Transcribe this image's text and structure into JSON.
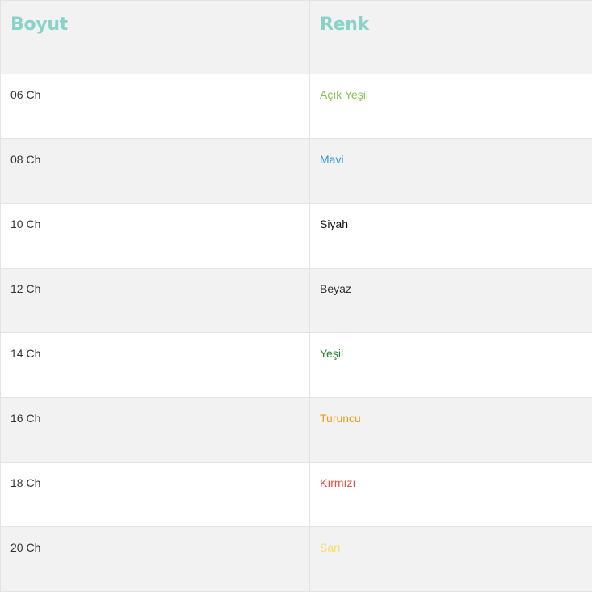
{
  "table": {
    "header_color": "#87d3c8",
    "headers": {
      "size": "Boyut",
      "color": "Renk"
    },
    "rows": [
      {
        "size": "06 Ch",
        "color": "Açık Yeşil",
        "color_hex": "#8cc152"
      },
      {
        "size": "08 Ch",
        "color": "Mavi",
        "color_hex": "#3498db"
      },
      {
        "size": "10 Ch",
        "color": "Siyah",
        "color_hex": "#111111"
      },
      {
        "size": "12 Ch",
        "color": "Beyaz",
        "color_hex": "#333333"
      },
      {
        "size": "14 Ch",
        "color": "Yeşil",
        "color_hex": "#2e7d32"
      },
      {
        "size": "16 Ch",
        "color": "Turuncu",
        "color_hex": "#f39c12"
      },
      {
        "size": "18 Ch",
        "color": "Kırmızı",
        "color_hex": "#e74c3c"
      },
      {
        "size": "20 Ch",
        "color": "Sarı",
        "color_hex": "#f7dc6f"
      }
    ]
  }
}
